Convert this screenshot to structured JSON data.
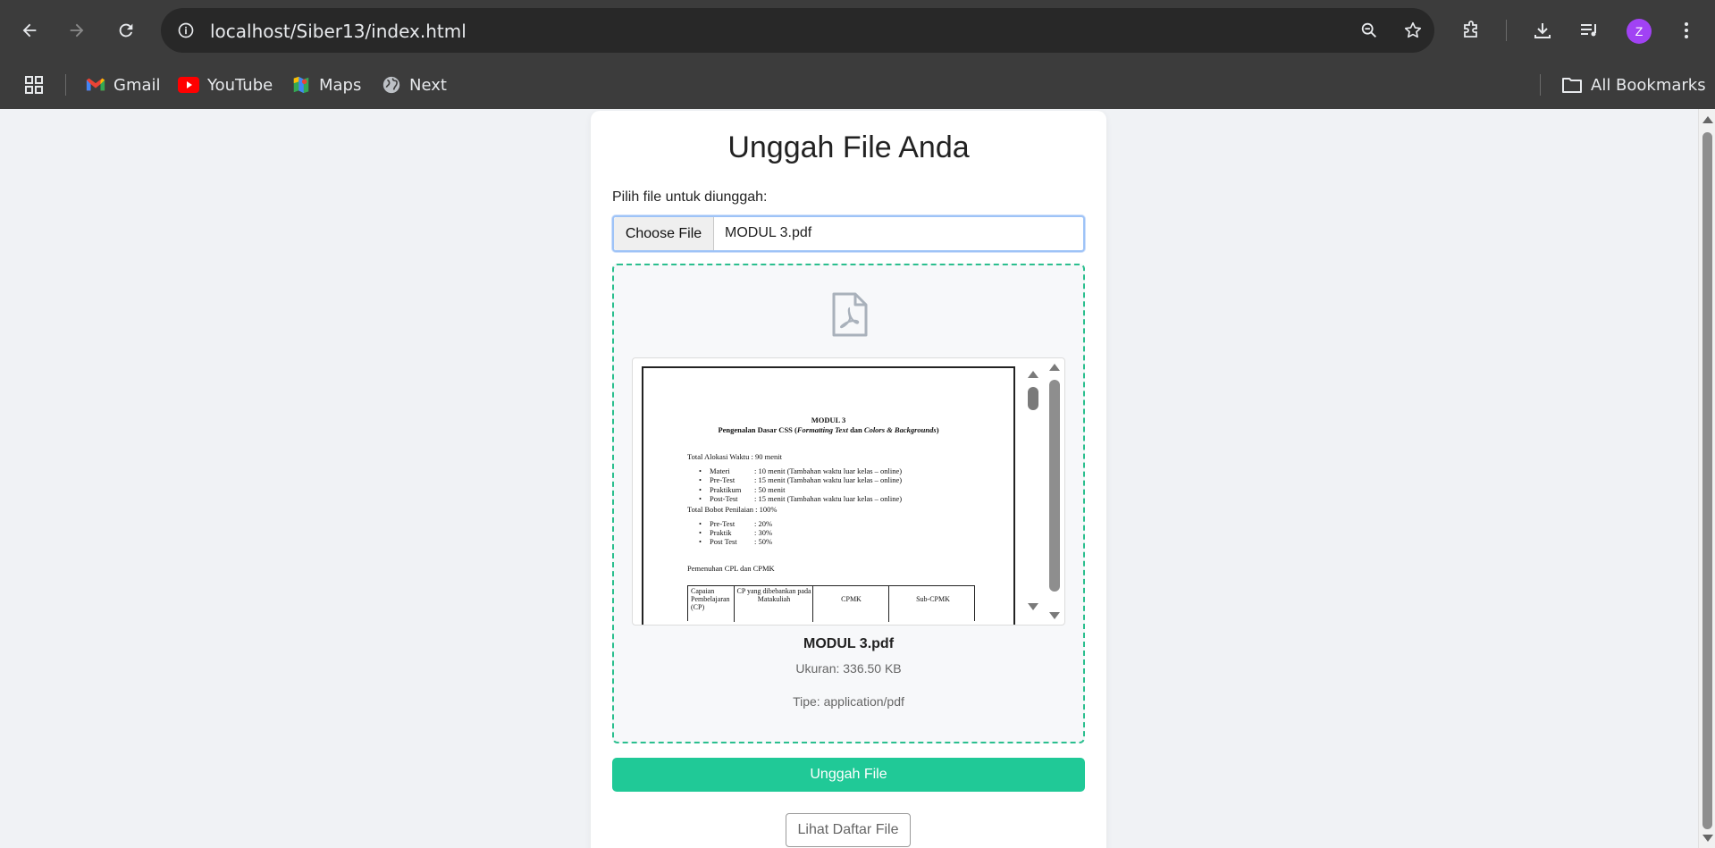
{
  "browser": {
    "url": "localhost/Siber13/index.html",
    "profile_initial": "Z",
    "bookmarks": [
      {
        "label": "Gmail",
        "icon": "gmail-icon"
      },
      {
        "label": "YouTube",
        "icon": "youtube-icon"
      },
      {
        "label": "Maps",
        "icon": "maps-icon"
      },
      {
        "label": "Next",
        "icon": "globe-icon"
      }
    ],
    "all_bookmarks": "All Bookmarks",
    "colors": {
      "avatar": "#a142f4"
    }
  },
  "page": {
    "title": "Unggah File Anda",
    "file_label": "Pilih file untuk diunggah:",
    "choose_button": "Choose File",
    "selected_file": "MODUL 3.pdf",
    "preview": {
      "file_icon": "pdf-file-icon",
      "pdf_title": "MODUL 3",
      "pdf_subtitle_prefix": "Pengenalan Dasar CSS (",
      "pdf_subtitle_italic_1": "Formatting Text",
      "pdf_subtitle_mid": " dan ",
      "pdf_subtitle_italic_2": "Colors & Backgrounds",
      "pdf_subtitle_suffix": ")",
      "alokasi": "Total Alokasi Waktu   : 90 menit",
      "alokasi_items": [
        {
          "name": "Materi",
          "value": ": 10 menit (Tambahan waktu luar kelas – online)"
        },
        {
          "name": "Pre-Test",
          "value": ": 15 menit (Tambahan waktu luar kelas – online)"
        },
        {
          "name": "Praktikum",
          "value": ": 50 menit"
        },
        {
          "name": "Post-Test",
          "value": ": 15 menit (Tambahan waktu luar kelas – online)"
        }
      ],
      "bobot": "Total Bobot Penilaian : 100%",
      "bobot_items": [
        {
          "name": "Pre-Test",
          "value": ": 20%"
        },
        {
          "name": "Praktik",
          "value": ": 30%"
        },
        {
          "name": "Post Test",
          "value": ": 50%"
        }
      ],
      "cpl_heading": "Pemenuhan CPL dan CPMK",
      "table_headers": [
        "Capaian Pembelajaran (CP)",
        "CP yang dibebankan pada Matakuliah",
        "CPMK",
        "Sub-CPMK"
      ]
    },
    "file_name": "MODUL 3.pdf",
    "file_size": "Ukuran: 336.50 KB",
    "file_type": "Tipe: application/pdf",
    "upload_button": "Unggah File",
    "list_button": "Lihat Daftar File",
    "colors": {
      "accent": "#20c997",
      "dropzone_border": "#2bbf8e"
    }
  }
}
